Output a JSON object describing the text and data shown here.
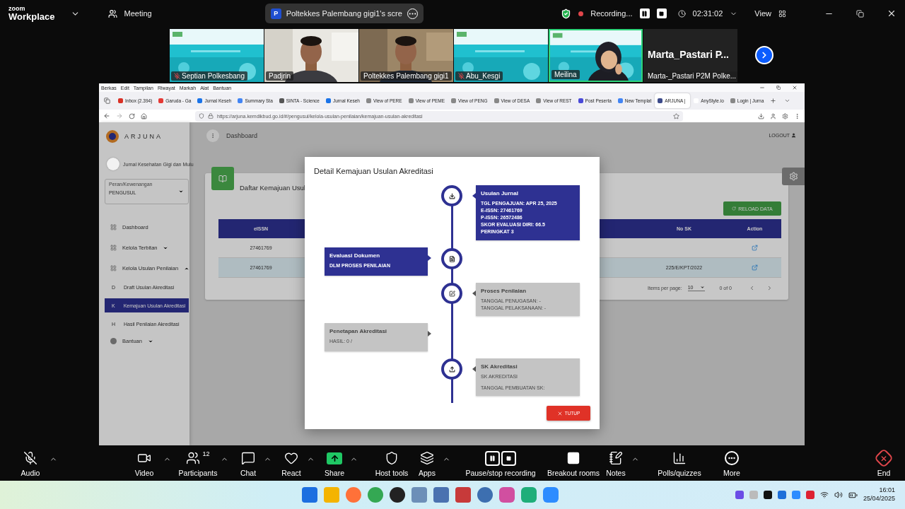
{
  "zoom_bar": {
    "brand_small": "zoom",
    "brand": "Workplace",
    "meeting": "Meeting",
    "share_badge": "P",
    "share_title": "Poltekkes Palembang gigi1's scre",
    "recording": "Recording...",
    "timer": "02:31:02",
    "view": "View"
  },
  "video_tiles": [
    {
      "name": "Septian Polkesbang",
      "muted": true,
      "speaking": false,
      "kind": "slide"
    },
    {
      "name": "Padjrin",
      "muted": false,
      "speaking": false,
      "kind": "camera"
    },
    {
      "name": "Poltekkes Palembang gigi1",
      "muted": false,
      "speaking": false,
      "kind": "camera"
    },
    {
      "name": "Abu_Kesgi",
      "muted": true,
      "speaking": false,
      "kind": "slide"
    },
    {
      "name": "Meilina",
      "muted": false,
      "speaking": true,
      "kind": "slide_camera"
    },
    {
      "name": "Marta-_Pastari P2M Polke...",
      "display_name": "Marta_Pastari P...",
      "muted": false,
      "speaking": false,
      "kind": "name"
    }
  ],
  "browser": {
    "menu": [
      "Berkas",
      "Edit",
      "Tampilan",
      "Riwayat",
      "Markah",
      "Alat",
      "Bantuan"
    ],
    "tabs": [
      {
        "label": "Inbox (2.394)",
        "selected": false
      },
      {
        "label": "Garuda - Ga",
        "selected": false
      },
      {
        "label": "Jurnal Keseh",
        "selected": false
      },
      {
        "label": "Summary Sta",
        "selected": false
      },
      {
        "label": "SINTA - Science",
        "selected": false
      },
      {
        "label": "Jurnal Keseh",
        "selected": false
      },
      {
        "label": "View of PERE",
        "selected": false
      },
      {
        "label": "View of PEME",
        "selected": false
      },
      {
        "label": "View of PENG",
        "selected": false
      },
      {
        "label": "View of DESA",
        "selected": false
      },
      {
        "label": "View of REST",
        "selected": false
      },
      {
        "label": "Post Peserta",
        "selected": false
      },
      {
        "label": "New Templat",
        "selected": false
      },
      {
        "label": "ARJUNA |",
        "selected": true
      },
      {
        "label": "AnyStyle.io",
        "selected": false
      },
      {
        "label": "Login | Jurna",
        "selected": false
      }
    ],
    "url": "https://arjuna.kemdikbud.go.id/#/pengusul/kelola-usulan-penilaian/kemajuan-usulan-akreditasi"
  },
  "page": {
    "app_name": "ARJUNA",
    "header_title": "Dashboard",
    "logout": "LOGOUT",
    "user": "Jurnal Kesehatan Gigi dan Mulu",
    "role_label": "Peran/Kewenangan",
    "role": "PENGUSUL",
    "nav": [
      {
        "label": "Dashboard"
      },
      {
        "label": "Kelola Terbitan",
        "expanded": false
      },
      {
        "label": "Kelola Usulan Penilaian",
        "expanded": true,
        "children": [
          {
            "letter": "D",
            "label": "Draft Usulan Akreditasi",
            "selected": false
          },
          {
            "letter": "K",
            "label": "Kemajuan Usulan Akreditasi",
            "selected": true
          },
          {
            "letter": "H",
            "label": "Hasil Penilaian Akreditasi",
            "selected": false
          }
        ]
      },
      {
        "label": "Bantuan",
        "expanded": false
      }
    ],
    "card_title": "Daftar Kemajuan Usul",
    "reload": "RELOAD DATA",
    "table": {
      "columns": [
        "eISSN",
        "No SK",
        "Action"
      ],
      "rows": [
        {
          "eissn": "27461769",
          "selected": false
        },
        {
          "eissn": "27461769",
          "no_sk": "225/E/KPT/2022",
          "selected": true
        }
      ]
    },
    "items_per_page_label": "Items per page:",
    "page_size": "10",
    "range": "0 of 0"
  },
  "modal": {
    "title": "Detail Kemajuan Usulan Akreditasi",
    "steps": [
      {
        "kind": "submission",
        "done": true,
        "title": "Usulan Jurnal",
        "lines": [
          "TGL PENGAJUAN: APR 25, 2025",
          "E-ISSN: 27461769",
          "P-ISSN: 26572486",
          "SKOR EVALUASI DIRI: 66.5",
          "PERINGKAT 3"
        ]
      },
      {
        "kind": "evaluation",
        "done": true,
        "title": "Evaluasi Dokumen",
        "lines": [
          "DLM PROSES PENILAIAN"
        ]
      },
      {
        "kind": "review",
        "done": false,
        "title": "Proses Penilaian",
        "lines": [
          "TANGGAL PENUGASAN: -",
          "TANGGAL PELAKSANAAN: -"
        ]
      },
      {
        "kind": "decision",
        "done": false,
        "title": "Penetapan Akreditasi",
        "lines": [
          "HASIL: 0 /"
        ]
      },
      {
        "kind": "decree",
        "done": false,
        "title": "SK Akreditasi",
        "lines": [
          "SK AKREDITASI",
          "TANGGAL PEMBUATAN SK:"
        ]
      }
    ],
    "close": "TUTUP"
  },
  "toolbar": [
    {
      "kind": "audio",
      "label": "Audio",
      "muted": true,
      "caret": true
    },
    {
      "kind": "video",
      "label": "Video",
      "caret": true
    },
    {
      "kind": "participants",
      "label": "Participants",
      "count": "12",
      "caret": true
    },
    {
      "kind": "chat",
      "label": "Chat",
      "caret": true
    },
    {
      "kind": "react",
      "label": "React",
      "caret": true
    },
    {
      "kind": "share",
      "label": "Share",
      "caret": true
    },
    {
      "kind": "host",
      "label": "Host tools",
      "caret": false
    },
    {
      "kind": "apps",
      "label": "Apps",
      "caret": true
    },
    {
      "kind": "record",
      "label": "Pause/stop recording",
      "caret": false
    },
    {
      "kind": "breakout",
      "label": "Breakout rooms",
      "caret": false
    },
    {
      "kind": "notes",
      "label": "Notes",
      "caret": true
    },
    {
      "kind": "polls",
      "label": "Polls/quizzes",
      "caret": false
    },
    {
      "kind": "more",
      "label": "More",
      "caret": false
    },
    {
      "kind": "end",
      "label": "End",
      "caret": false
    }
  ],
  "taskbar": {
    "time": "16:01",
    "date": "25/04/2025"
  }
}
